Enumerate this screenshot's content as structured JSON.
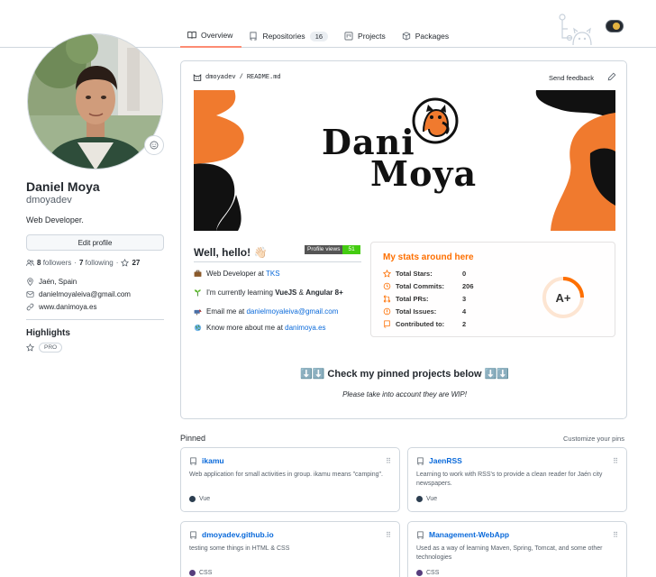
{
  "tabs": [
    {
      "label": "Overview",
      "icon": "book-icon"
    },
    {
      "label": "Repositories",
      "icon": "repo-icon",
      "count": "16"
    },
    {
      "label": "Projects",
      "icon": "project-icon"
    },
    {
      "label": "Packages",
      "icon": "package-icon"
    }
  ],
  "profile": {
    "name": "Daniel Moya",
    "login": "dmoyadev",
    "bio": "Web Developer.",
    "edit_label": "Edit profile",
    "followers": "8",
    "followers_label": "followers",
    "following": "7",
    "following_label": "following",
    "stars": "27",
    "location": "Jaén, Spain",
    "email": "danielmoyaleiva@gmail.com",
    "website": "www.danimoya.es",
    "highlights_title": "Highlights",
    "highlight_badge": "PRO"
  },
  "readme": {
    "path_user": "dmoyadev",
    "path_sep": "/",
    "path_file": "README.md",
    "feedback": "Send feedback",
    "logo_line1": "Dani",
    "logo_line2": "Moya",
    "hello": "Well, hello! 👋🏻",
    "views_label": "Profile views",
    "views_count": "51",
    "items": [
      {
        "pre": "Web Developer at ",
        "link": "TKS",
        "post": ""
      },
      {
        "pre": "I'm currently learning ",
        "bold": "VueJS",
        "mid": " & ",
        "bold2": "Angular 8+"
      },
      {
        "pre": "Email me at ",
        "link": "danielmoyaleiva@gmail.com",
        "post": ""
      },
      {
        "pre": "Know more about me at ",
        "link": "danimoya.es",
        "post": ""
      }
    ],
    "pinned_heading": "⬇️⬇️ Check my pinned projects below ⬇️⬇️",
    "wip_note": "Please take into account they are WIP!"
  },
  "stats": {
    "title": "My stats around here",
    "rows": [
      {
        "label": "Total Stars:",
        "value": "0"
      },
      {
        "label": "Total Commits:",
        "value": "206"
      },
      {
        "label": "Total PRs:",
        "value": "3"
      },
      {
        "label": "Total Issues:",
        "value": "4"
      },
      {
        "label": "Contributed to:",
        "value": "2"
      }
    ],
    "grade": "A+",
    "accent": "#fe6f00"
  },
  "pinned": {
    "title": "Pinned",
    "customize": "Customize your pins",
    "repos": [
      {
        "name": "ikamu",
        "desc": "Web application for small activities in group. ikamu means \"camping\".",
        "lang": "Vue",
        "lang_color": "#2c3e50"
      },
      {
        "name": "JaenRSS",
        "desc": "Learning to work with RSS's to provide a clean reader for Jaén city newspapers.",
        "lang": "Vue",
        "lang_color": "#2c3e50"
      },
      {
        "name": "dmoyadev.github.io",
        "desc": "testing some things in HTML & CSS",
        "lang": "CSS",
        "lang_color": "#563d7c"
      },
      {
        "name": "Management-WebApp",
        "desc": "Used as a way of learning Maven, Spring, Tomcat, and some other technologies",
        "lang": "CSS",
        "lang_color": "#563d7c"
      }
    ]
  }
}
